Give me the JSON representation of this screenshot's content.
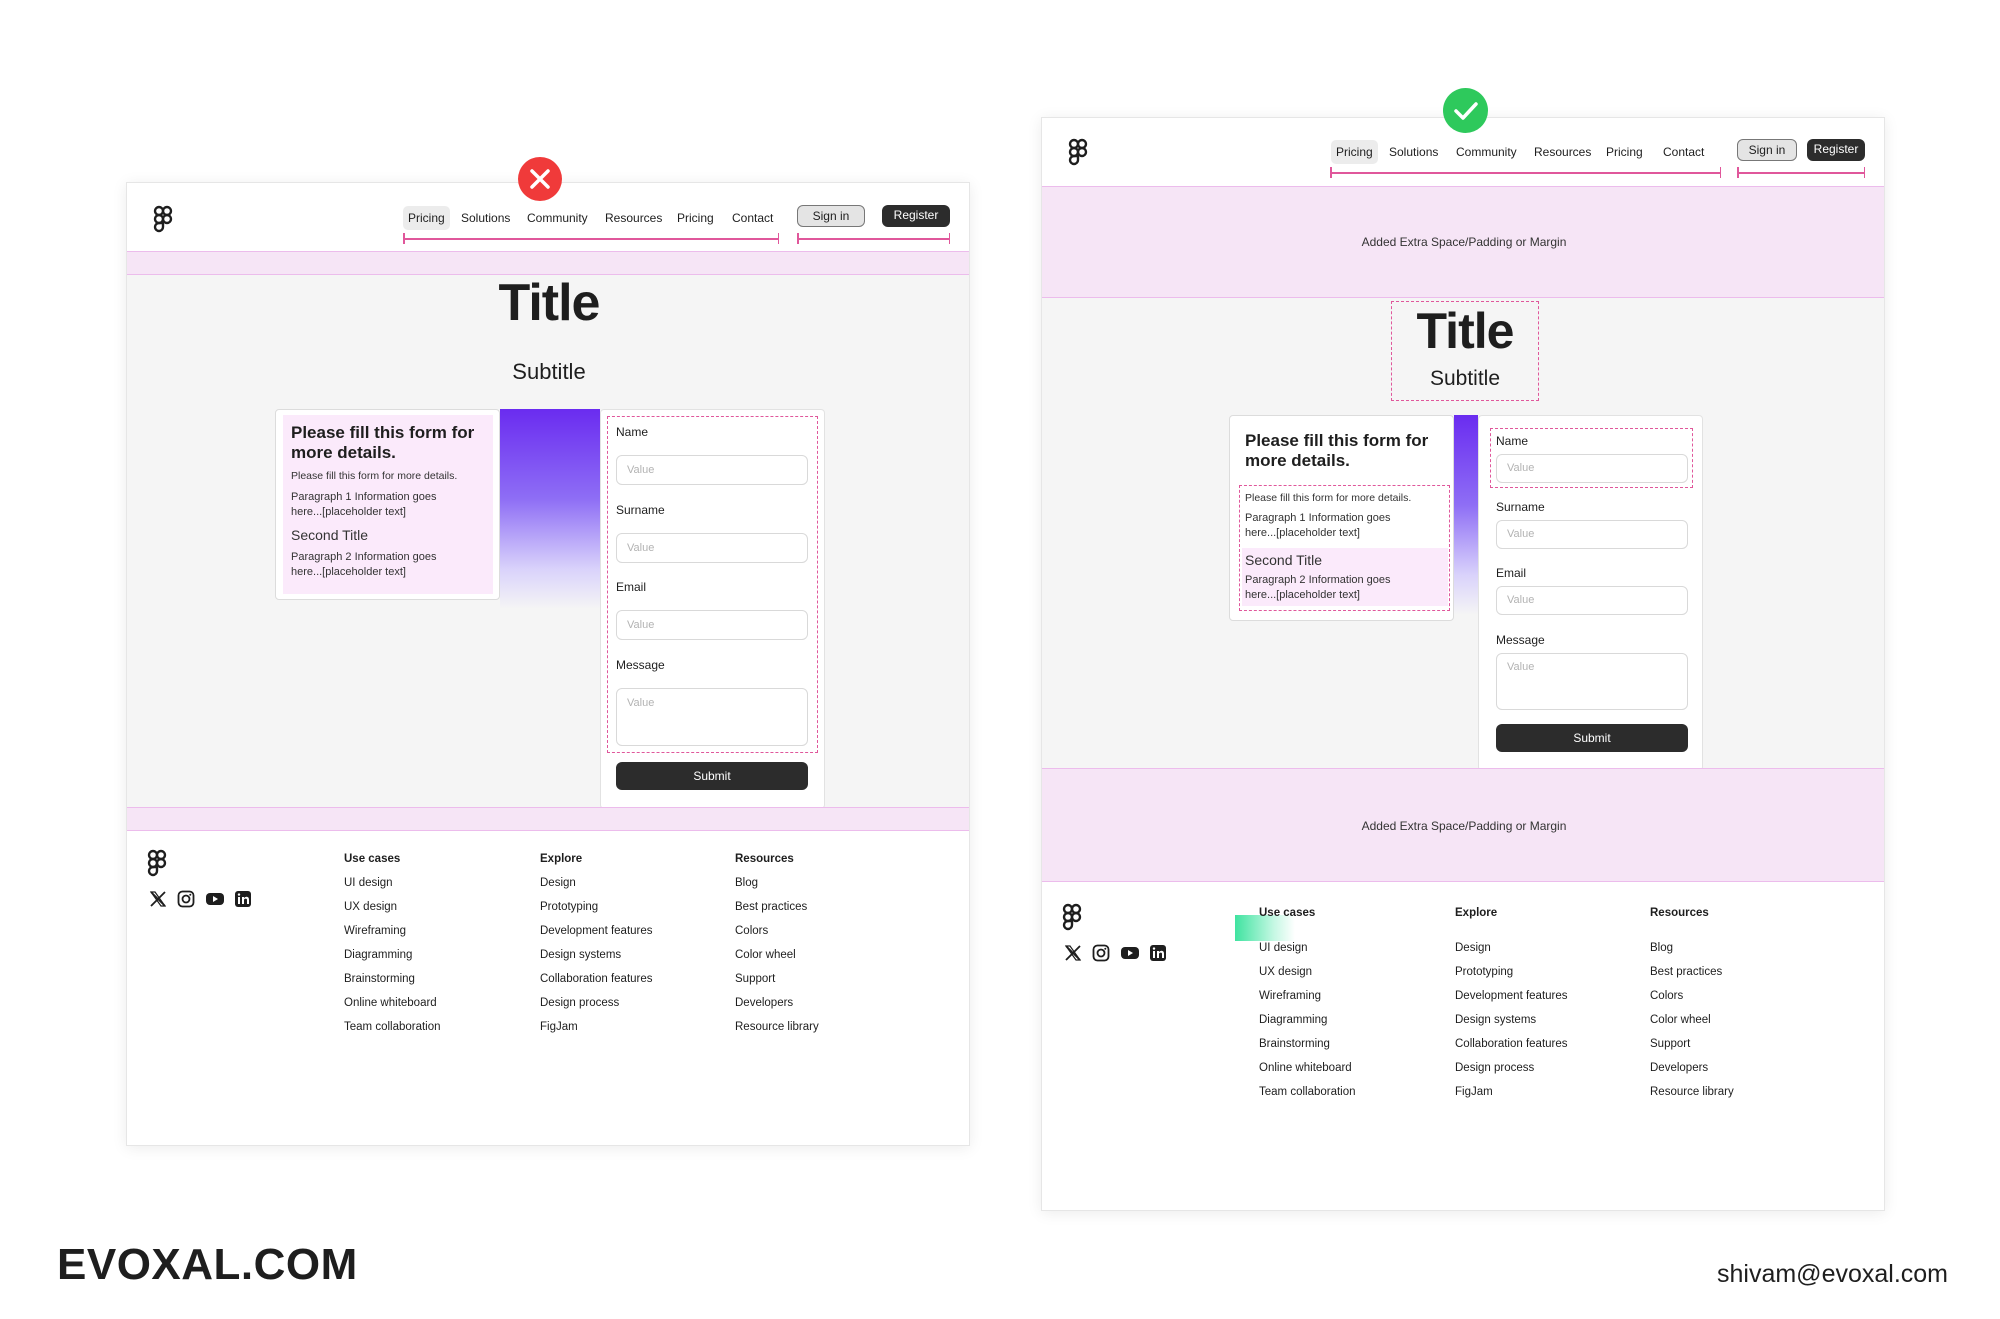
{
  "nav": {
    "items": [
      "Pricing",
      "Solutions",
      "Community",
      "Resources",
      "Pricing",
      "Contact"
    ],
    "sign_in": "Sign in",
    "register": "Register"
  },
  "hero": {
    "title": "Title",
    "subtitle": "Subtitle"
  },
  "spacing_label": "Added Extra Space/Padding or Margin",
  "info": {
    "heading": "Please fill this form for more details.",
    "intro": "Please fill this form for more details.",
    "paragraph1": "Paragraph 1 Information goes here...[placeholder text]",
    "second_title": "Second Title",
    "paragraph2": "Paragraph 2 Information goes here...[placeholder text]"
  },
  "form": {
    "fields": [
      {
        "label": "Name",
        "placeholder": "Value"
      },
      {
        "label": "Surname",
        "placeholder": "Value"
      },
      {
        "label": "Email",
        "placeholder": "Value"
      },
      {
        "label": "Message",
        "placeholder": "Value"
      }
    ],
    "submit": "Submit"
  },
  "footer": {
    "columns": [
      {
        "heading": "Use cases",
        "links": [
          "UI design",
          "UX design",
          "Wireframing",
          "Diagramming",
          "Brainstorming",
          "Online whiteboard",
          "Team collaboration"
        ]
      },
      {
        "heading": "Explore",
        "links": [
          "Design",
          "Prototyping",
          "Development features",
          "Design systems",
          "Collaboration features",
          "Design process",
          "FigJam"
        ]
      },
      {
        "heading": "Resources",
        "links": [
          "Blog",
          "Best practices",
          "Colors",
          "Color wheel",
          "Support",
          "Developers",
          "Resource library"
        ]
      }
    ],
    "social_icons": [
      "x-icon",
      "instagram-icon",
      "youtube-icon",
      "linkedin-icon"
    ]
  },
  "branding": {
    "site": "EVOXAL.COM",
    "email": "shivam@evoxal.com"
  },
  "colors": {
    "bad": "#f03a3a",
    "good": "#2ec95c",
    "spacing_band": "#f6e5f6",
    "measure_line": "#e0579b",
    "gradient": "#6a2cf0"
  }
}
